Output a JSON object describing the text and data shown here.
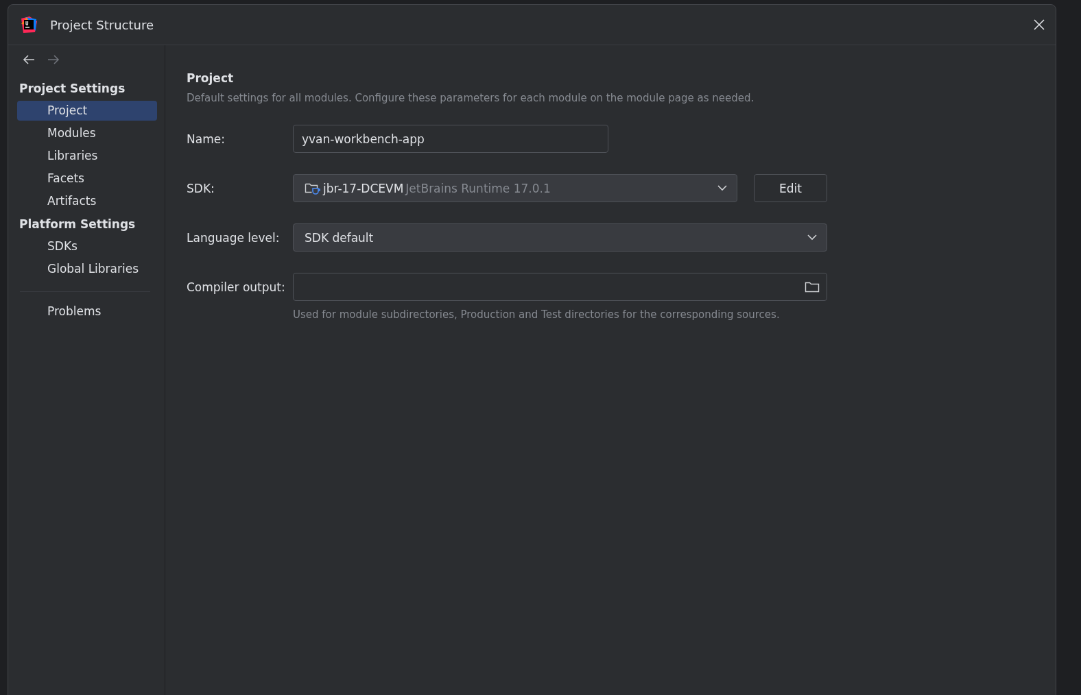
{
  "window": {
    "title": "Project Structure"
  },
  "sidebar": {
    "sections": [
      {
        "heading": "Project Settings",
        "items": [
          {
            "label": "Project",
            "selected": true
          },
          {
            "label": "Modules",
            "selected": false
          },
          {
            "label": "Libraries",
            "selected": false
          },
          {
            "label": "Facets",
            "selected": false
          },
          {
            "label": "Artifacts",
            "selected": false
          }
        ]
      },
      {
        "heading": "Platform Settings",
        "items": [
          {
            "label": "SDKs",
            "selected": false
          },
          {
            "label": "Global Libraries",
            "selected": false
          }
        ]
      }
    ],
    "extra_items": [
      {
        "label": "Problems",
        "selected": false
      }
    ]
  },
  "page": {
    "title": "Project",
    "description": "Default settings for all modules. Configure these parameters for each module on the module page as needed.",
    "fields": [
      {
        "kind": "text",
        "label": "Name:",
        "value": "yvan-workbench-app"
      },
      {
        "kind": "sdk",
        "label": "SDK:",
        "value": "jbr-17-DCEVM",
        "detail": "JetBrains Runtime 17.0.1",
        "button": "Edit"
      },
      {
        "kind": "dropdown",
        "label": "Language level:",
        "value": "SDK default"
      },
      {
        "kind": "path",
        "label": "Compiler output:",
        "hint": "Used for module subdirectories, Production and Test directories for the corresponding sources."
      }
    ]
  }
}
